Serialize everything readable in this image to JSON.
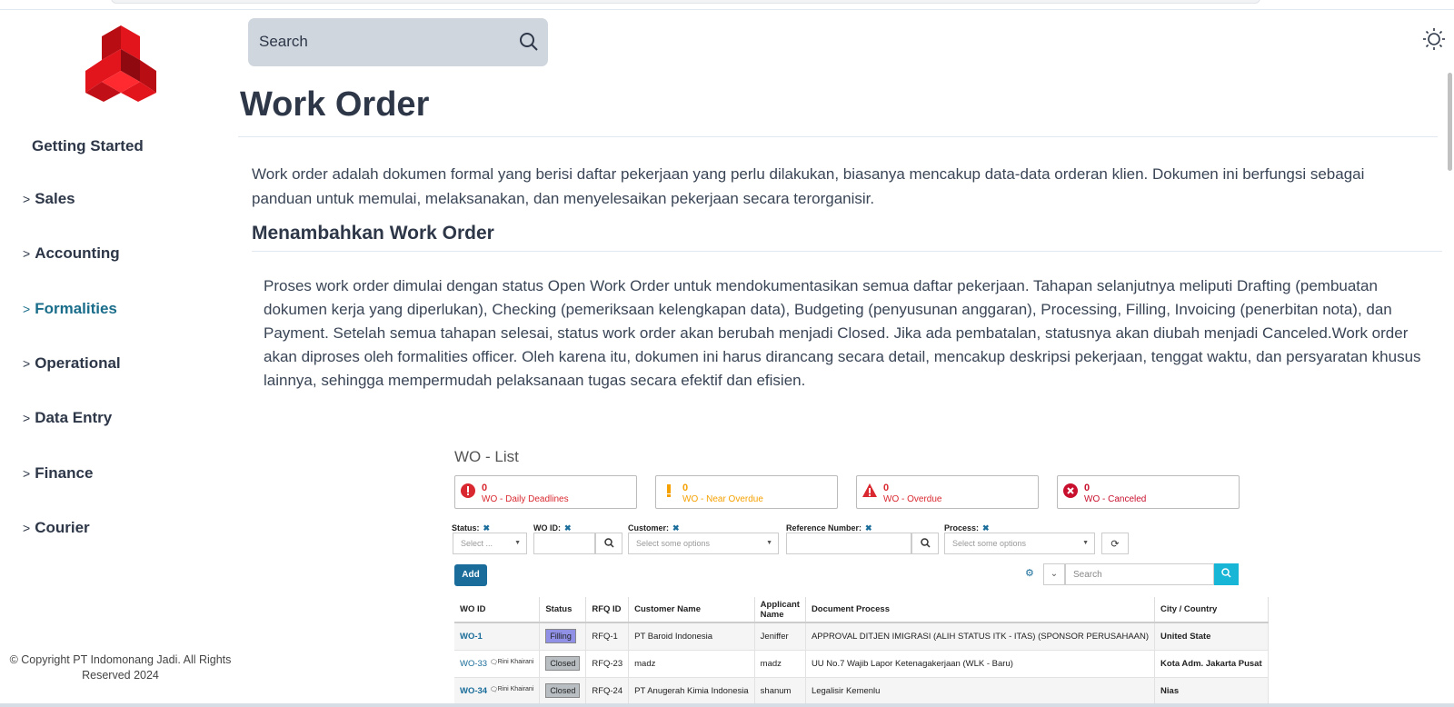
{
  "search": {
    "placeholder": "Search"
  },
  "sidebar": {
    "getting_started": "Getting Started",
    "items": [
      {
        "label": "Sales"
      },
      {
        "label": "Accounting"
      },
      {
        "label": "Formalities"
      },
      {
        "label": "Operational"
      },
      {
        "label": "Data Entry"
      },
      {
        "label": "Finance"
      },
      {
        "label": "Courier"
      }
    ],
    "active": "Formalities",
    "copyright": "© Copyright PT Indomonang Jadi. All Rights Reserved 2024"
  },
  "main": {
    "title": "Work Order",
    "intro": "Work order adalah dokumen formal yang berisi daftar pekerjaan yang perlu dilakukan, biasanya mencakup data-data orderan klien. Dokumen ini berfungsi sebagai panduan untuk memulai, melaksanakan, dan menyelesaikan pekerjaan secara terorganisir.",
    "section_title": "Menambahkan Work Order",
    "section_body": "Proses work order dimulai dengan status Open Work Order untuk mendokumentasikan semua daftar pekerjaan. Tahapan selanjutnya meliputi Drafting (pembuatan dokumen kerja yang diperlukan), Checking (pemeriksaan kelengkapan data), Budgeting (penyusunan anggaran), Processing, Filling, Invoicing (penerbitan nota), dan Payment. Setelah semua tahapan selesai, status work order akan berubah menjadi Closed. Jika ada pembatalan, statusnya akan diubah menjadi Canceled.Work order akan diproses oleh formalities officer. Oleh karena itu, dokumen ini harus dirancang secara detail, mencakup deskripsi pekerjaan, tenggat waktu, dan persyaratan khusus lainnya, sehingga mempermudah pelaksanaan tugas secara efektif dan efisien."
  },
  "screenshot": {
    "title": "WO - List",
    "kpis": [
      {
        "count": "0",
        "label": "WO - Daily Deadlines",
        "color": "#d9282f"
      },
      {
        "count": "0",
        "label": "WO - Near Overdue",
        "color": "#f5a100"
      },
      {
        "count": "0",
        "label": "WO - Overdue",
        "color": "#d9282f"
      },
      {
        "count": "0",
        "label": "WO - Canceled",
        "color": "#c8102e"
      }
    ],
    "filters": {
      "status_label": "Status:",
      "status_placeholder": "Select ...",
      "woid_label": "WO ID:",
      "customer_label": "Customer:",
      "customer_placeholder": "Select some options",
      "ref_label": "Reference Number:",
      "process_label": "Process:",
      "process_placeholder": "Select some options"
    },
    "add_label": "Add",
    "search_placeholder": "Search",
    "columns": [
      "WO ID",
      "Status",
      "RFQ ID",
      "Customer Name",
      "Applicant Name",
      "Document Process",
      "City / Country"
    ],
    "rows": [
      {
        "wo_id": "WO-1",
        "assignee": "",
        "status": "Filling",
        "rfq": "RFQ-1",
        "customer": "PT Baroid Indonesia",
        "applicant": "Jeniffer",
        "process": "APPROVAL DITJEN IMIGRASI (ALIH STATUS ITK - ITAS) (SPONSOR PERUSAHAAN)",
        "city": "United State"
      },
      {
        "wo_id": "WO-33",
        "assignee": "Rini Khairani",
        "status": "Closed",
        "rfq": "RFQ-23",
        "customer": "madz",
        "applicant": "madz",
        "process": "UU No.7 Wajib Lapor Ketenagakerjaan (WLK - Baru)",
        "city": "Kota Adm. Jakarta Pusat"
      },
      {
        "wo_id": "WO-34",
        "assignee": "Rini Khairani",
        "status": "Closed",
        "rfq": "RFQ-24",
        "customer": "PT Anugerah Kimia Indonesia",
        "applicant": "shanum",
        "process": "Legalisir Kemenlu",
        "city": "Nias"
      }
    ]
  }
}
